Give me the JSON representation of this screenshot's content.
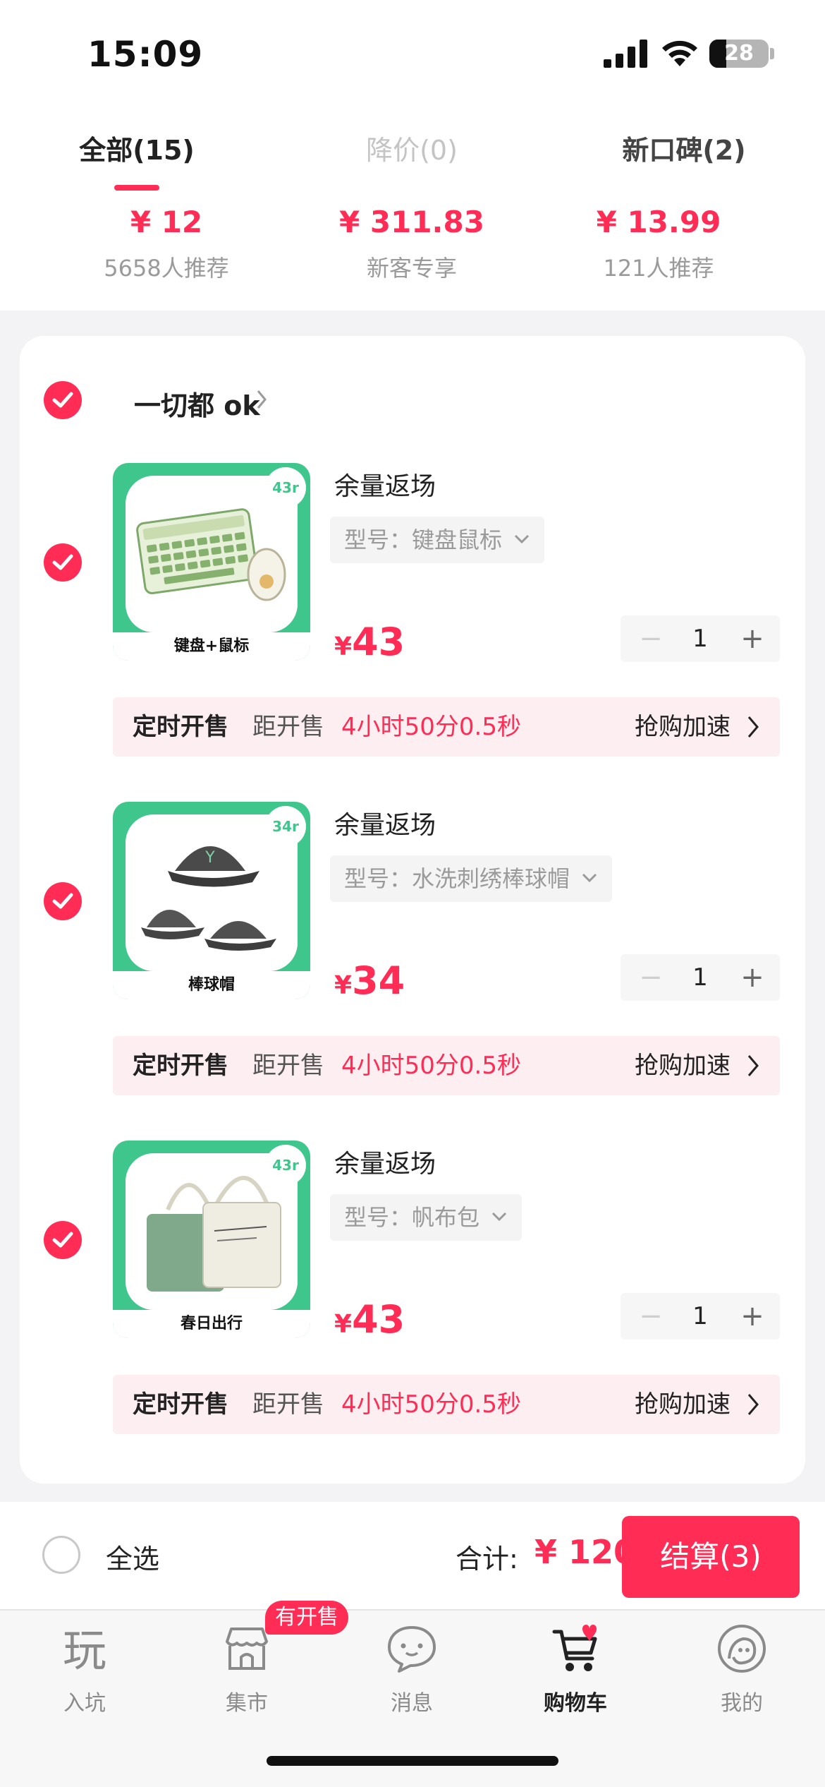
{
  "status": {
    "time": "15:09",
    "battery": "28",
    "battery_level": 0.28
  },
  "tabs": [
    {
      "label": "全部(15)"
    },
    {
      "label": "降价(0)"
    },
    {
      "label": "新口碑(2)"
    }
  ],
  "recommend": [
    {
      "price": "¥ 12",
      "desc": "5658人推荐"
    },
    {
      "price": "¥ 311.83",
      "desc": "新客专享"
    },
    {
      "price": "¥ 13.99",
      "desc": "121人推荐"
    }
  ],
  "shop": {
    "name": "一切都 ok"
  },
  "items": [
    {
      "title": "余量返场",
      "spec": "型号：键盘鼠标",
      "price_symbol": "¥",
      "price": "43",
      "qty": "1",
      "thumb_caption": "键盘+鼠标",
      "thumb_badge": "43r",
      "timer_label": "定时开售",
      "timer_pre": "距开售",
      "timer_count": "4小时50分0.5秒",
      "timer_cta": "抢购加速"
    },
    {
      "title": "余量返场",
      "spec": "型号：水洗刺绣棒球帽",
      "price_symbol": "¥",
      "price": "34",
      "qty": "1",
      "thumb_caption": "棒球帽",
      "thumb_badge": "34r",
      "timer_label": "定时开售",
      "timer_pre": "距开售",
      "timer_count": "4小时50分0.5秒",
      "timer_cta": "抢购加速"
    },
    {
      "title": "余量返场",
      "spec": "型号：帆布包",
      "price_symbol": "¥",
      "price": "43",
      "qty": "1",
      "thumb_caption": "春日出行",
      "thumb_badge": "43r",
      "timer_label": "定时开售",
      "timer_pre": "距开售",
      "timer_count": "4小时50分0.5秒",
      "timer_cta": "抢购加速"
    }
  ],
  "stepper": {
    "minus": "−",
    "plus": "+"
  },
  "footer": {
    "select_all": "全选",
    "total_label": "合计:",
    "total_value": "¥ 120",
    "checkout": "结算(3)"
  },
  "tabbar": {
    "badge": "有开售",
    "items": [
      {
        "label": "入坑",
        "icon": "play-icon"
      },
      {
        "label": "集市",
        "icon": "market-icon"
      },
      {
        "label": "消息",
        "icon": "message-icon"
      },
      {
        "label": "购物车",
        "icon": "cart-icon"
      },
      {
        "label": "我的",
        "icon": "profile-icon"
      }
    ]
  },
  "colors": {
    "accent": "#ff2c55",
    "thumb_green": "#3ec68d",
    "timer_bg": "#fdeff1"
  }
}
